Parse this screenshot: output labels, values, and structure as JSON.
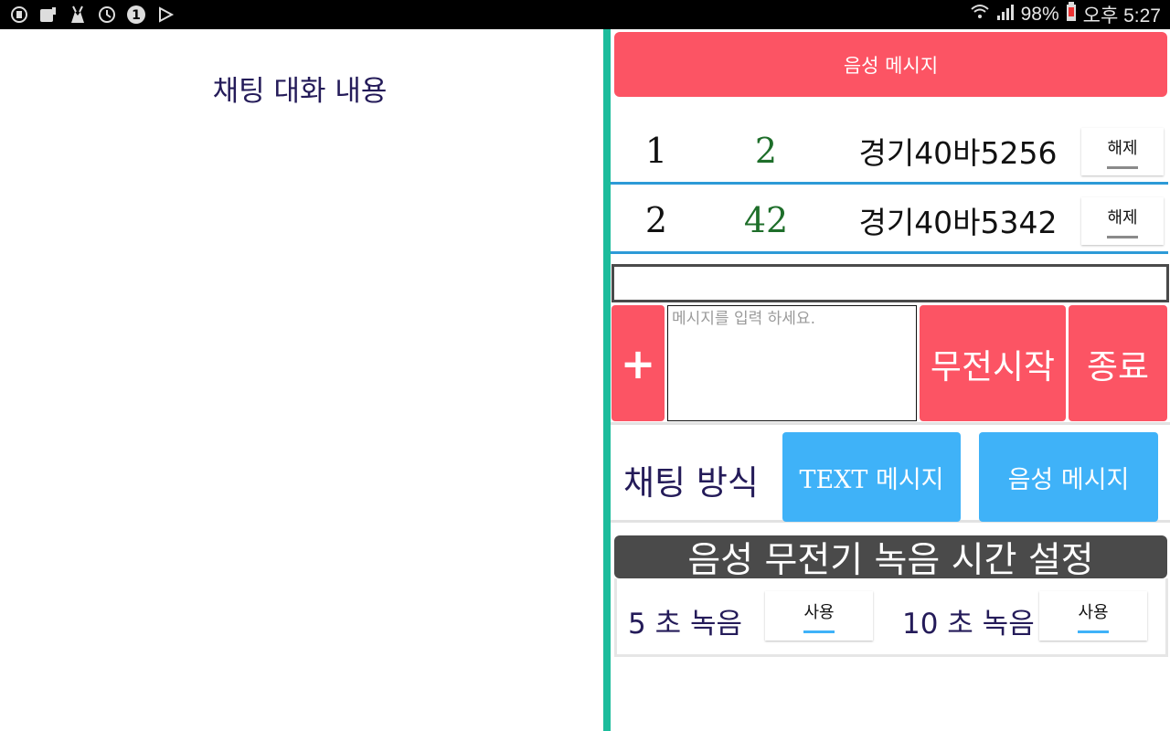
{
  "statusbar": {
    "battery": "98%",
    "time": "오후 5:27",
    "left_icons": [
      "app-icon",
      "notification-icon",
      "pokemon-icon",
      "sync-icon",
      "badge-one-icon",
      "play-store-icon"
    ],
    "badge_number": "1"
  },
  "chat": {
    "title": "채팅 대화 내용"
  },
  "voice_banner": {
    "label": "음성 메시지"
  },
  "buses": [
    {
      "num": "1",
      "count": "2",
      "plate": "경기40바5256",
      "action": "해제"
    },
    {
      "num": "2",
      "count": "42",
      "plate": "경기40바5342",
      "action": "해제"
    }
  ],
  "input": {
    "strip_value": "",
    "placeholder": "메시지를 입력 하세요.",
    "plus_label": "+",
    "start_label": "무전시작",
    "end_label": "종료"
  },
  "mode": {
    "label": "채팅 방식",
    "text_btn": "TEXT 메시지",
    "voice_btn": "음성 메시지"
  },
  "recording": {
    "header": "음성 무전기 녹음 시간 설정",
    "opt5_label": "5 초 녹음",
    "opt5_btn": "사용",
    "opt10_label": "10 초 녹음",
    "opt10_btn": "사용"
  },
  "colors": {
    "accent_red": "#fc5464",
    "accent_blue": "#3fb2f8",
    "divider": "#1cbc9c",
    "row_line": "#2d9ad7"
  }
}
